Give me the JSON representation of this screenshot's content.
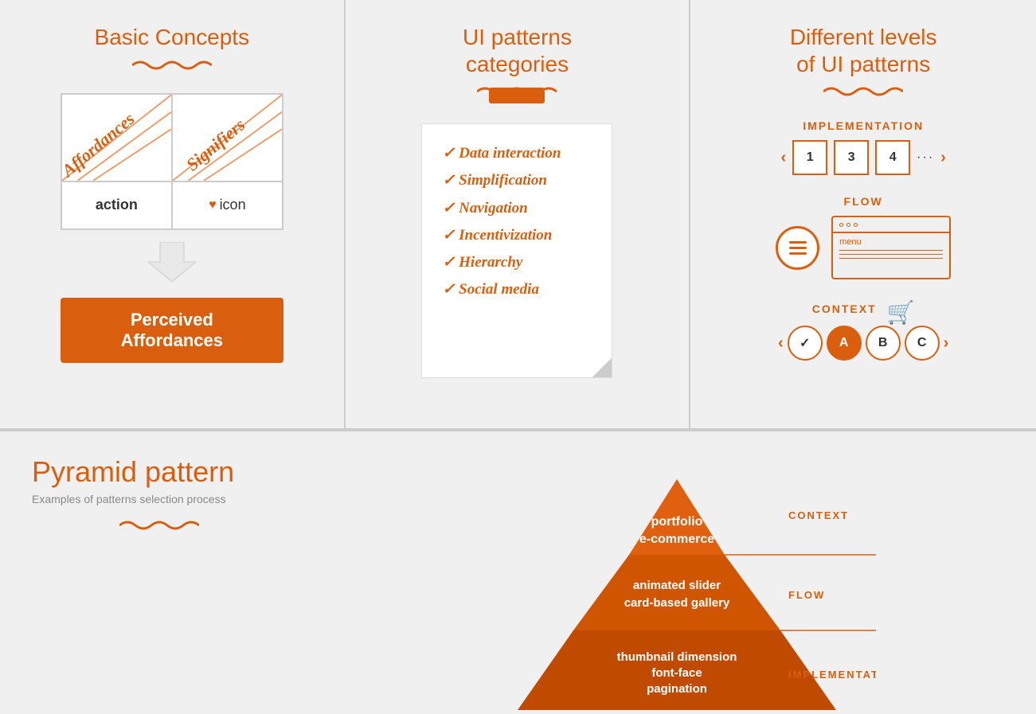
{
  "sections": {
    "basic_concepts": {
      "title": "Basic Concepts",
      "affordances_label": "Affordances",
      "signifiers_label": "Signifiers",
      "action_label": "action",
      "icon_label": "icon",
      "perceived_label": "Perceived Affordances"
    },
    "ui_patterns": {
      "title_line1": "UI patterns",
      "title_line2": "categories",
      "items": [
        "✓ Data interaction",
        "✓ Simplification",
        "✓ Navigation",
        "✓ Incentivization",
        "✓ Hierarchy",
        "✓ Social media"
      ]
    },
    "levels": {
      "title_line1": "Different levels",
      "title_line2": "of UI patterns",
      "implementation": {
        "label": "IMPLEMENTATION",
        "pages": [
          "1",
          "3",
          "4"
        ],
        "dots": "..."
      },
      "flow": {
        "label": "FLOW",
        "menu_text": "menu"
      },
      "context": {
        "label": "CONTEXT",
        "steps": [
          "✓",
          "A",
          "B",
          "C"
        ]
      }
    },
    "pyramid": {
      "title": "Pyramid pattern",
      "subtitle": "Examples of patterns selection process",
      "levels": [
        {
          "label": "CONTEXT",
          "items": [
            "portfolio",
            "e-commerce"
          ]
        },
        {
          "label": "FLOW",
          "items": [
            "animated slider",
            "card-based gallery"
          ]
        },
        {
          "label": "IMPLEMENTATION",
          "items": [
            "thumbnail dimension",
            "font-face",
            "pagination"
          ]
        }
      ]
    }
  }
}
